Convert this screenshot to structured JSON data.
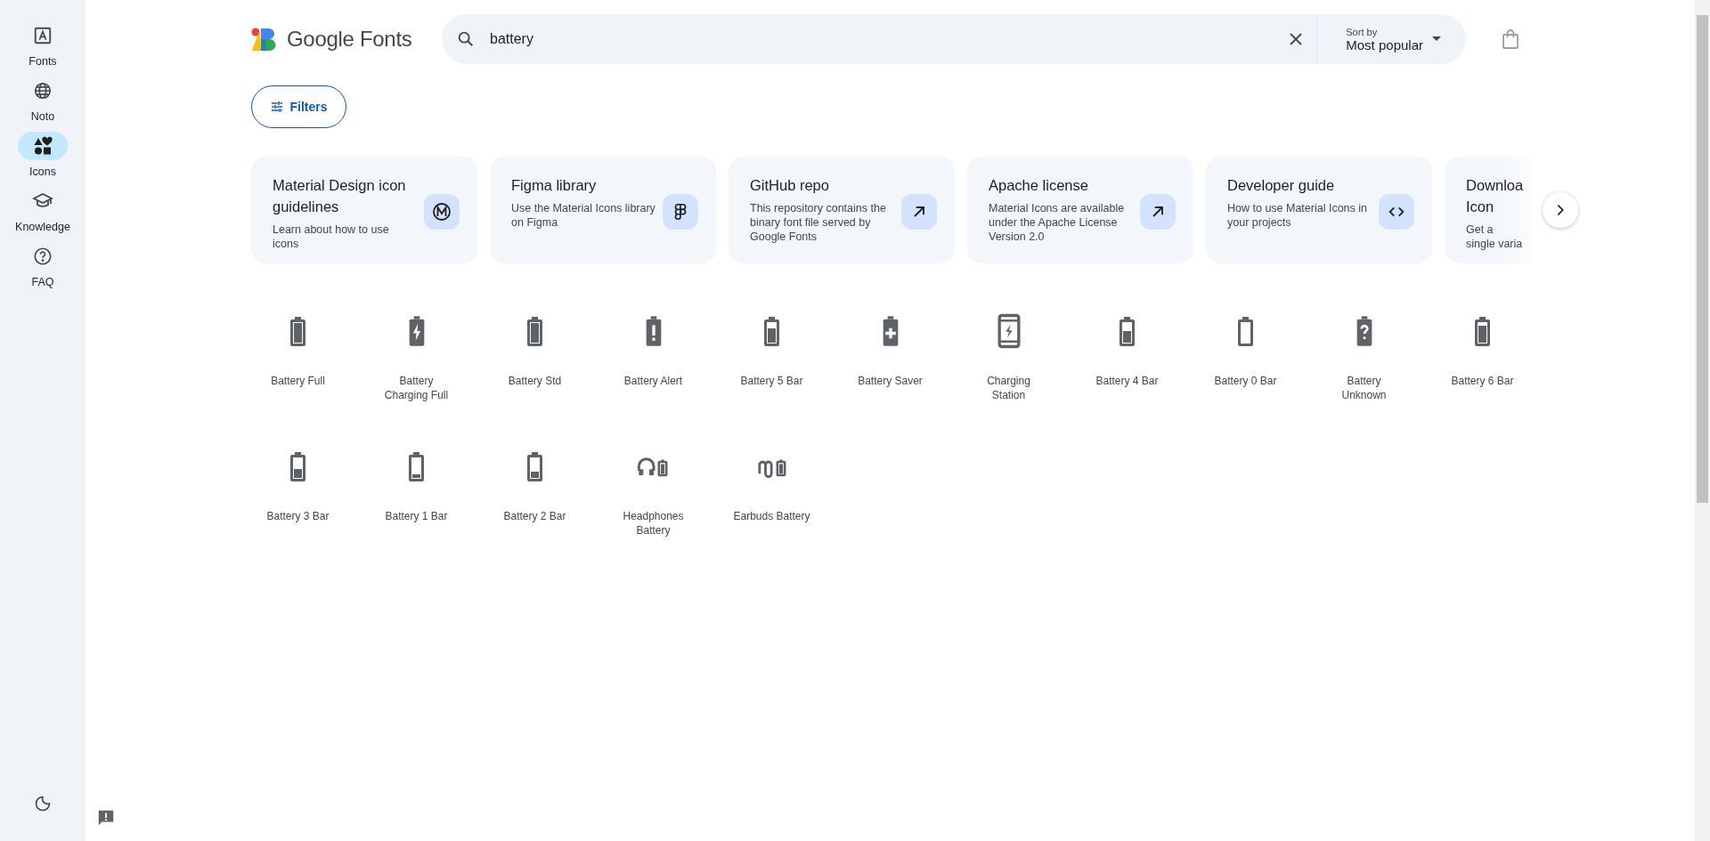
{
  "sidebar": {
    "items": [
      {
        "label": "Fonts",
        "selected": false
      },
      {
        "label": "Noto",
        "selected": false
      },
      {
        "label": "Icons",
        "selected": true
      },
      {
        "label": "Knowledge",
        "selected": false
      },
      {
        "label": "FAQ",
        "selected": false
      }
    ]
  },
  "header": {
    "brand": "Google Fonts",
    "search": {
      "value": "battery"
    },
    "sort": {
      "label": "Sort by",
      "value": "Most popular"
    }
  },
  "filters_button": "Filters",
  "cards": [
    {
      "title": "Material Design icon guidelines",
      "description": "Learn about how to use icons"
    },
    {
      "title": "Figma library",
      "description": "Use the Material Icons library on Figma"
    },
    {
      "title": "GitHub repo",
      "description": "This repository contains the binary font file served by Google Fonts"
    },
    {
      "title": "Apache license",
      "description": "Material Icons are available under the Apache License Version 2.0"
    },
    {
      "title": "Developer guide",
      "description": "How to use Material Icons in your projects"
    },
    {
      "title": "Downloa\nIcon",
      "description": "Get a\nsingle varia"
    }
  ],
  "icons": [
    {
      "kind": "battery-full",
      "label": "Battery Full"
    },
    {
      "kind": "battery-charging",
      "label": "Battery\nCharging Full"
    },
    {
      "kind": "battery-std",
      "label": "Battery Std"
    },
    {
      "kind": "battery-alert",
      "label": "Battery Alert"
    },
    {
      "kind": "battery-5-bar",
      "label": "Battery 5 Bar"
    },
    {
      "kind": "battery-saver",
      "label": "Battery Saver"
    },
    {
      "kind": "charging-station",
      "label": "Charging\nStation"
    },
    {
      "kind": "battery-4-bar",
      "label": "Battery 4 Bar"
    },
    {
      "kind": "battery-0-bar",
      "label": "Battery 0 Bar"
    },
    {
      "kind": "battery-unknown",
      "label": "Battery\nUnknown"
    },
    {
      "kind": "battery-6-bar",
      "label": "Battery 6 Bar"
    },
    {
      "kind": "battery-3-bar",
      "label": "Battery 3 Bar"
    },
    {
      "kind": "battery-1-bar",
      "label": "Battery 1 Bar"
    },
    {
      "kind": "battery-2-bar",
      "label": "Battery 2 Bar"
    },
    {
      "kind": "headphones-battery",
      "label": "Headphones\nBattery"
    },
    {
      "kind": "earbuds-battery",
      "label": "Earbuds Battery"
    }
  ]
}
